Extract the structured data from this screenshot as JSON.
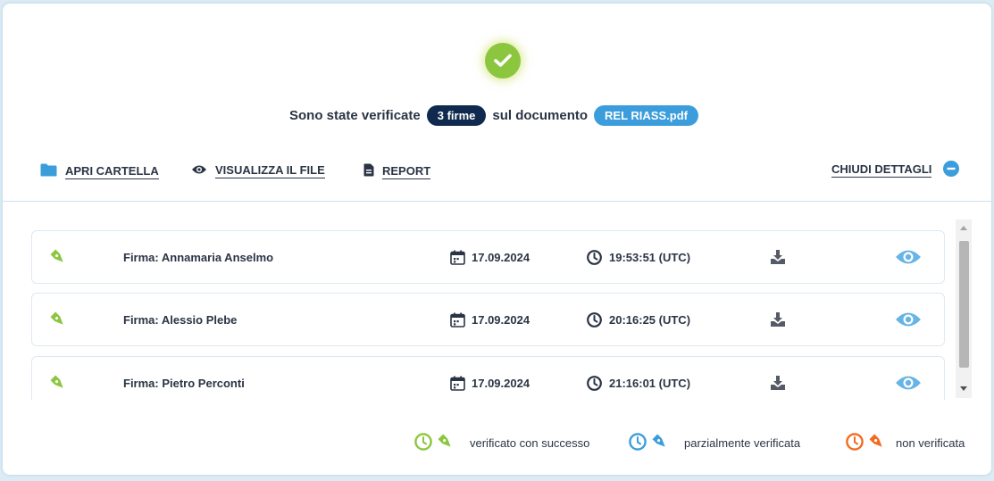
{
  "header": {
    "prefix": "Sono state verificate",
    "count_badge": "3 firme",
    "middle": "sul documento",
    "document_badge": "REL RIASS.pdf"
  },
  "toolbar": {
    "open_folder": "APRI CARTELLA",
    "view_file": "VISUALIZZA IL FILE",
    "report": "REPORT",
    "close_details": "CHIUDI DETTAGLI"
  },
  "signatures": [
    {
      "name": "Firma: Annamaria Anselmo",
      "date": "17.09.2024",
      "time": "19:53:51 (UTC)",
      "status": "verified"
    },
    {
      "name": "Firma: Alessio Plebe",
      "date": "17.09.2024",
      "time": "20:16:25 (UTC)",
      "status": "verified"
    },
    {
      "name": "Firma: Pietro Perconti",
      "date": "17.09.2024",
      "time": "21:16:01 (UTC)",
      "status": "verified"
    }
  ],
  "legend": {
    "success": "verificato con successo",
    "partial": "parzialmente verificata",
    "failed": "non verificata"
  },
  "colors": {
    "success": "#8cc63f",
    "partial": "#3b9ddb",
    "failed": "#f26b21",
    "dark_badge": "#0f2a4e"
  },
  "icons": {
    "header": "check-circle-icon",
    "toolbar": [
      "folder-icon",
      "eye-icon",
      "document-icon",
      "minus-circle-icon"
    ],
    "row": [
      "pen-nib-icon",
      "calendar-icon",
      "clock-icon",
      "download-icon",
      "eye-icon"
    ]
  }
}
